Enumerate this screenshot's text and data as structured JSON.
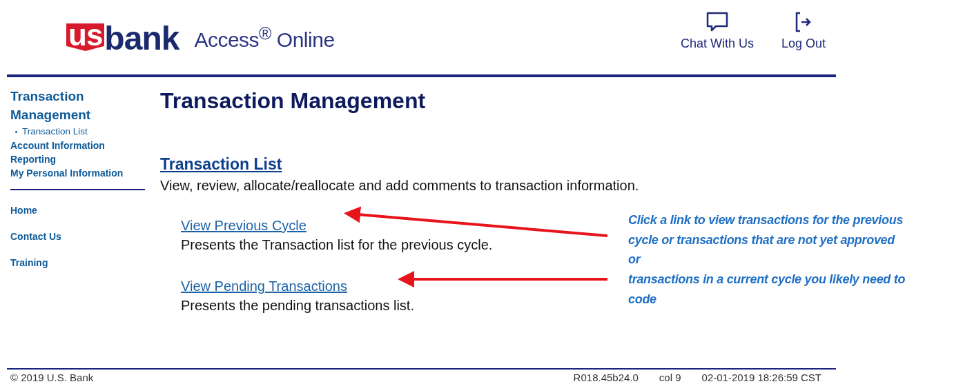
{
  "header": {
    "logo": {
      "shield_text": "us",
      "word": "bank"
    },
    "product": "Access$^{®}$ Online",
    "actions": [
      {
        "kind": "chat",
        "label": "Chat With Us"
      },
      {
        "kind": "logout",
        "label": "Log Out"
      }
    ]
  },
  "sidebar": {
    "section": "Transaction Management",
    "subitems": [
      "Transaction List"
    ],
    "items": [
      "Account Information",
      "Reporting",
      "My Personal Information"
    ],
    "links": [
      "Home",
      "Contact Us",
      "Training"
    ]
  },
  "main": {
    "title": "Transaction Management",
    "section_title": "Transaction List",
    "section_description": "View, review, allocate/reallocate and add comments to transaction information.",
    "links": [
      {
        "label": "View Previous Cycle",
        "description": "Presents the Transaction list for the previous cycle."
      },
      {
        "label": "View Pending Transactions",
        "description": "Presents the pending transactions list."
      }
    ]
  },
  "annotation": {
    "lines": [
      "Click a link to view transactions for the previous",
      "cycle or transactions that are not yet approved",
      "or",
      "transactions in a current cycle you likely need to",
      "code"
    ]
  },
  "footer": {
    "copyright": "© 2019 U.S. Bank",
    "version": "R018.45b24.0",
    "column": "col 9",
    "timestamp": "02-01-2019 18:26:59 CST"
  }
}
